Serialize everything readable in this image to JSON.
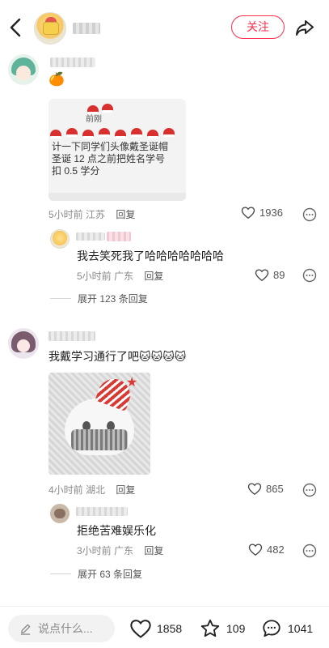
{
  "header": {
    "follow_label": "关注"
  },
  "comments": [
    {
      "emoji": "🍊",
      "image": {
        "header_text": "前刚",
        "caption_lines": [
          "计一下同学们头像戴圣诞帽",
          "圣诞 12 点之前把姓名学号",
          "扣 0.5 学分"
        ]
      },
      "time": "5小时前",
      "location": "江苏",
      "reply_label": "回复",
      "likes": "1936",
      "reply": {
        "text": "我去笑死我了哈哈哈哈哈哈哈",
        "time": "5小时前",
        "location": "广东",
        "reply_label": "回复",
        "likes": "89"
      },
      "expand_label": "展开 123 条回复"
    },
    {
      "text": "我戴学习通行了吧🐱🐱🐱🐱",
      "time": "4小时前",
      "location": "湖北",
      "reply_label": "回复",
      "likes": "865",
      "reply": {
        "text": "拒绝苦难娱乐化",
        "time": "3小时前",
        "location": "广东",
        "reply_label": "回复",
        "likes": "482"
      },
      "expand_label": "展开 63 条回复"
    }
  ],
  "bottom_bar": {
    "input_placeholder": "说点什么...",
    "likes": "1858",
    "favorites": "109",
    "comments": "1041"
  },
  "colors": {
    "accent": "#ff2e4d",
    "meta_text": "#8a8a8a"
  }
}
